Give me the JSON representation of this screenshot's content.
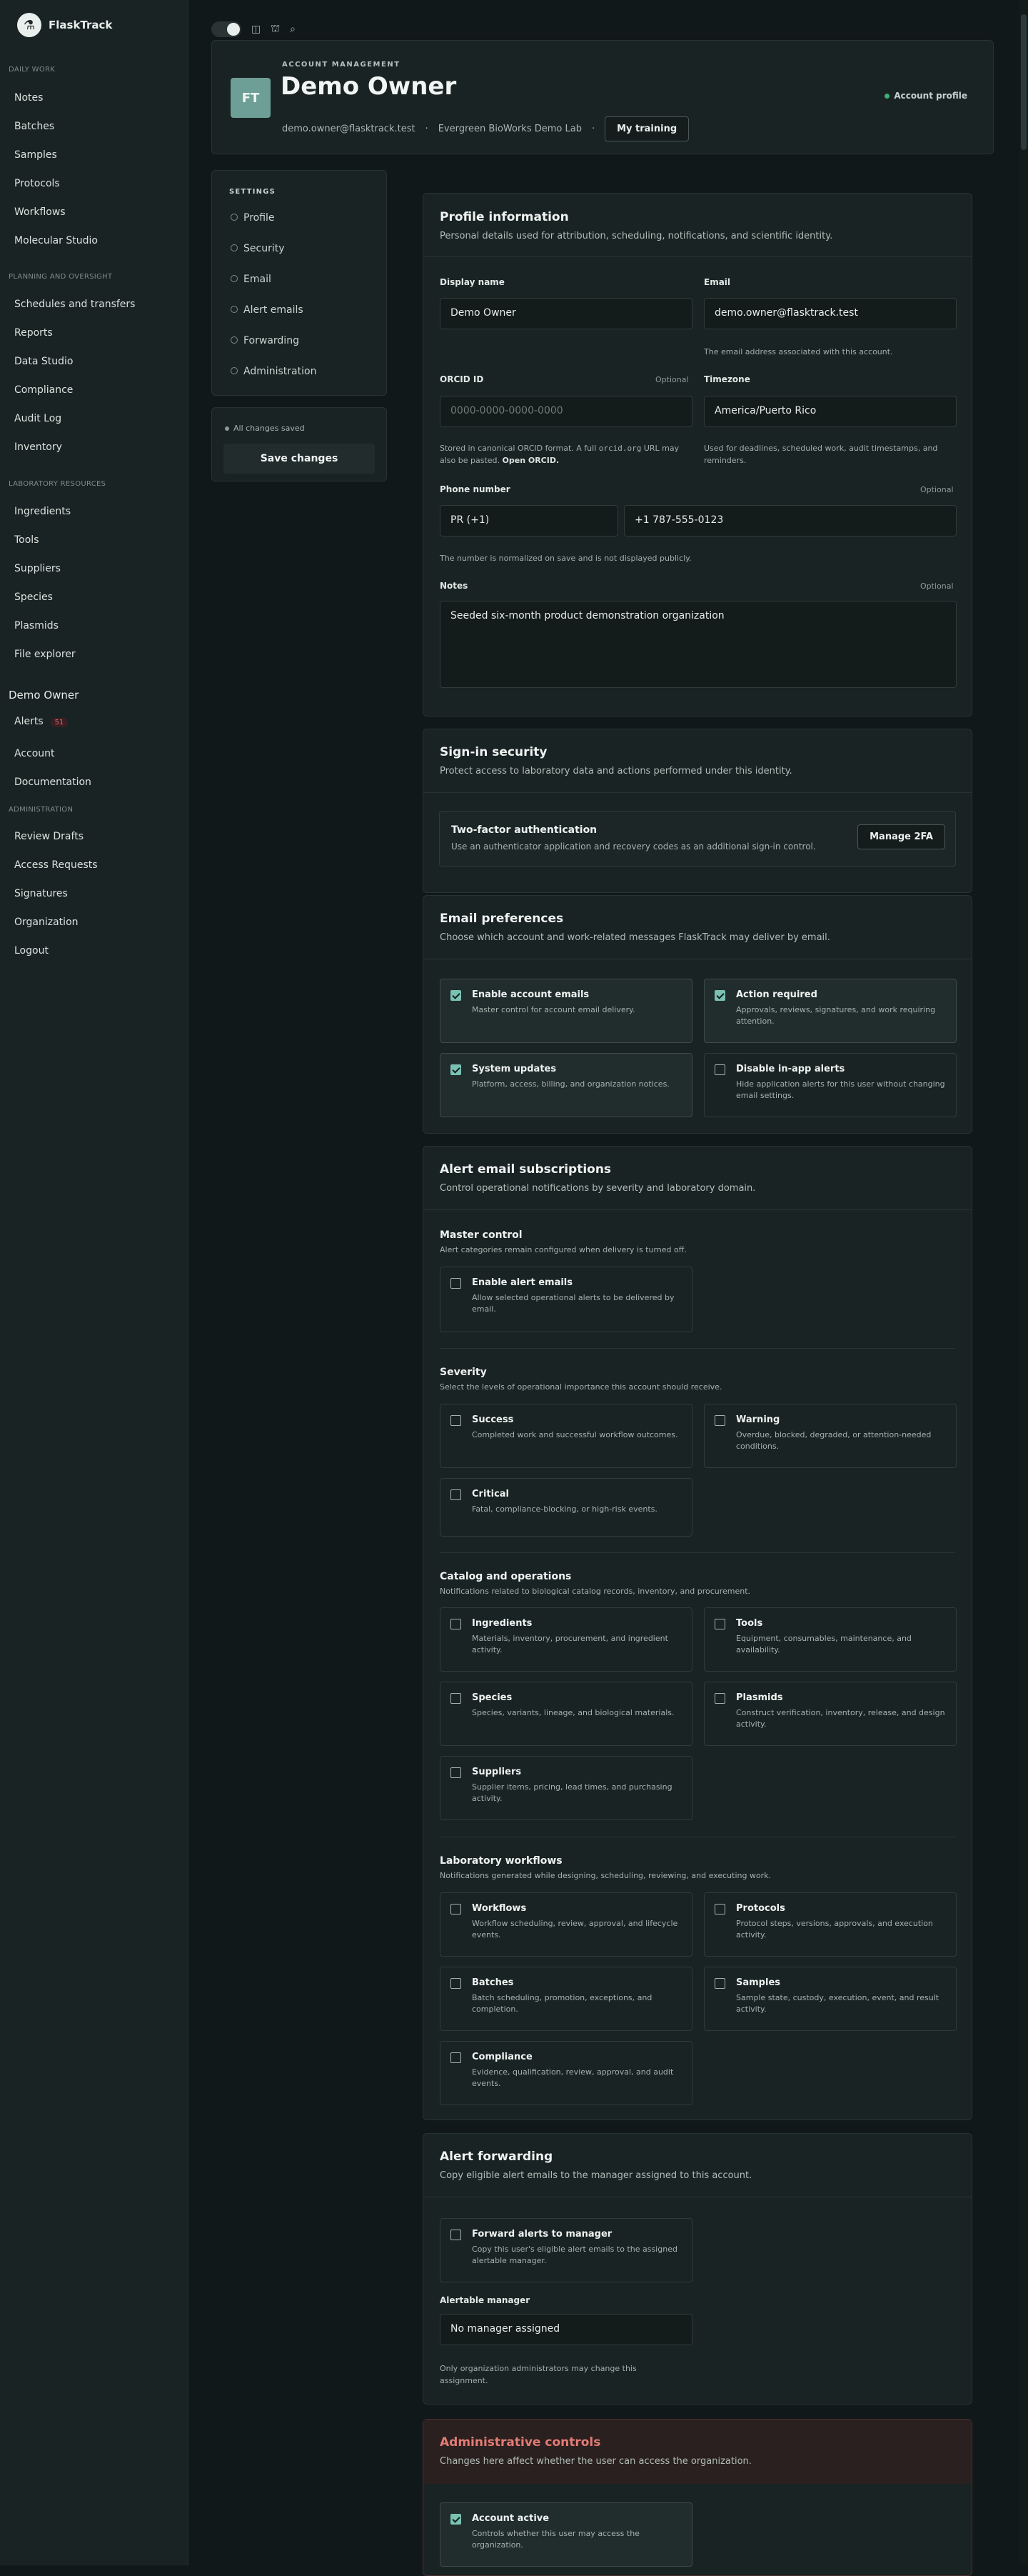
{
  "sidebar": {
    "brand": "FlaskTrack",
    "sec_daily": "DAILY WORK",
    "daily": [
      "Notes",
      "Batches",
      "Samples",
      "Protocols",
      "Workflows",
      "Molecular Studio"
    ],
    "sec_plan": "PLANNING AND OVERSIGHT",
    "plan": [
      "Schedules and transfers",
      "Reports",
      "Data Studio",
      "Compliance",
      "Audit Log",
      "Inventory"
    ],
    "sec_lab": "LABORATORY RESOURCES",
    "lab": [
      "Ingredients",
      "Tools",
      "Suppliers",
      "Species",
      "Plasmids",
      "File explorer"
    ],
    "user": "Demo Owner",
    "alerts": "Alerts",
    "alerts_badge": "51",
    "account": "Account",
    "docs": "Documentation",
    "sec_admin": "ADMINISTRATION",
    "admin": [
      "Review Drafts",
      "Access Requests",
      "Signatures",
      "Organization",
      "Logout"
    ]
  },
  "toolbar": {
    "theme_icon": "moon-icon",
    "layout_icon": "columns-icon",
    "tree_icon": "hierarchy-icon",
    "search_icon": "search-icon"
  },
  "header": {
    "initials": "FT",
    "eyebrow": "ACCOUNT MANAGEMENT",
    "title": "Demo Owner",
    "email": "demo.owner@flasktrack.test",
    "org": "Evergreen BioWorks Demo Lab",
    "training": "My training",
    "profile_pill": "Account profile"
  },
  "settings": {
    "heading": "SETTINGS",
    "items": [
      "Profile",
      "Security",
      "Email",
      "Alert emails",
      "Forwarding",
      "Administration"
    ],
    "saved": "All changes saved",
    "save": "Save changes"
  },
  "profile": {
    "title": "Profile information",
    "subtitle": "Personal details used for attribution, scheduling, notifications, and scientific identity.",
    "display_label": "Display name",
    "display_value": "Demo Owner",
    "email_label": "Email",
    "email_value": "demo.owner@flasktrack.test",
    "email_help": "The email address associated with this account.",
    "orcid_label": "ORCID ID",
    "optional": "Optional",
    "orcid_ph": "0000-0000-0000-0000",
    "orcid_help_a": "Stored in canonical ORCID format. A full ",
    "orcid_help_code": "orcid.org",
    "orcid_help_b": " URL may also be pasted. ",
    "orcid_link": "Open ORCID.",
    "tz_label": "Timezone",
    "tz_value": "America/Puerto Rico",
    "tz_help": "Used for deadlines, scheduled work, audit timestamps, and reminders.",
    "phone_label": "Phone number",
    "phone_cc": "PR (+1)",
    "phone_value": "+1 787-555-0123",
    "phone_help": "The number is normalized on save and is not displayed publicly.",
    "notes_label": "Notes",
    "notes_value": "Seeded six-month product demonstration organization"
  },
  "security": {
    "title": "Sign-in security",
    "subtitle": "Protect access to laboratory data and actions performed under this identity.",
    "tfa_title": "Two-factor authentication",
    "tfa_desc": "Use an authenticator application and recovery codes as an additional sign-in control.",
    "tfa_btn": "Manage 2FA"
  },
  "email": {
    "title": "Email preferences",
    "subtitle": "Choose which account and work-related messages FlaskTrack may deliver by email.",
    "items": [
      {
        "t": "Enable account emails",
        "d": "Master control for account email delivery.",
        "on": true
      },
      {
        "t": "Action required",
        "d": "Approvals, reviews, signatures, and work requiring attention.",
        "on": true
      },
      {
        "t": "System updates",
        "d": "Platform, access, billing, and organization notices.",
        "on": true
      },
      {
        "t": "Disable in-app alerts",
        "d": "Hide application alerts for this user without changing email settings.",
        "on": false
      }
    ]
  },
  "alerts": {
    "title": "Alert email subscriptions",
    "subtitle": "Control operational notifications by severity and laboratory domain.",
    "master_h": "Master control",
    "master_s": "Alert categories remain configured when delivery is turned off.",
    "master": {
      "t": "Enable alert emails",
      "d": "Allow selected operational alerts to be delivered by email."
    },
    "sev_h": "Severity",
    "sev_s": "Select the levels of operational importance this account should receive.",
    "sev": [
      {
        "t": "Success",
        "d": "Completed work and successful workflow outcomes."
      },
      {
        "t": "Warning",
        "d": "Overdue, blocked, degraded, or attention-needed conditions."
      },
      {
        "t": "Critical",
        "d": "Fatal, compliance-blocking, or high-risk events."
      }
    ],
    "cat_h": "Catalog and operations",
    "cat_s": "Notifications related to biological catalog records, inventory, and procurement.",
    "cat": [
      {
        "t": "Ingredients",
        "d": "Materials, inventory, procurement, and ingredient activity."
      },
      {
        "t": "Tools",
        "d": "Equipment, consumables, maintenance, and availability."
      },
      {
        "t": "Species",
        "d": "Species, variants, lineage, and biological materials."
      },
      {
        "t": "Plasmids",
        "d": "Construct verification, inventory, release, and design activity."
      },
      {
        "t": "Suppliers",
        "d": "Supplier items, pricing, lead times, and purchasing activity."
      }
    ],
    "lab_h": "Laboratory workflows",
    "lab_s": "Notifications generated while designing, scheduling, reviewing, and executing work.",
    "lab": [
      {
        "t": "Workflows",
        "d": "Workflow scheduling, review, approval, and lifecycle events."
      },
      {
        "t": "Protocols",
        "d": "Protocol steps, versions, approvals, and execution activity."
      },
      {
        "t": "Batches",
        "d": "Batch scheduling, promotion, exceptions, and completion."
      },
      {
        "t": "Samples",
        "d": "Sample state, custody, execution, event, and result activity."
      },
      {
        "t": "Compliance",
        "d": "Evidence, qualification, review, approval, and audit events."
      }
    ]
  },
  "forwarding": {
    "title": "Alert forwarding",
    "subtitle": "Copy eligible alert emails to the manager assigned to this account.",
    "chk": {
      "t": "Forward alerts to manager",
      "d": "Copy this user's eligible alert emails to the assigned alertable manager."
    },
    "mgr_label": "Alertable manager",
    "mgr_value": "No manager assigned",
    "mgr_help": "Only organization administrators may change this assignment."
  },
  "admin": {
    "title": "Administrative controls",
    "subtitle": "Changes here affect whether the user can access the organization.",
    "chk": {
      "t": "Account active",
      "d": "Controls whether this user may access the organization."
    }
  }
}
